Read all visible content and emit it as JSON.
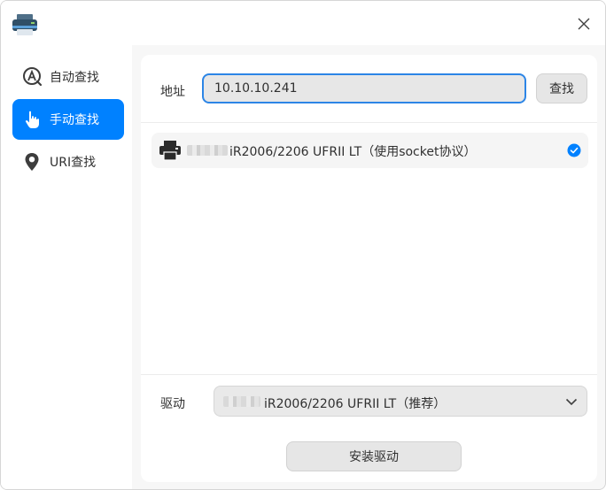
{
  "sidebar": {
    "items": [
      {
        "label": "自动查找",
        "icon": "auto-search-icon",
        "active": false
      },
      {
        "label": "手动查找",
        "icon": "hand-pointer-icon",
        "active": true
      },
      {
        "label": "URI查找",
        "icon": "location-pin-icon",
        "active": false
      }
    ]
  },
  "address": {
    "label": "地址",
    "value": "10.10.10.241",
    "search_label": "查找"
  },
  "printer": {
    "name": "iR2006/2206 UFRII LT（使用socket协议）",
    "selected": true
  },
  "driver": {
    "label": "驱动",
    "selected": "iR2006/2206 UFRII LT（推荐）"
  },
  "install_label": "安装驱动",
  "colors": {
    "accent": "#0081ff",
    "input_border": "#2c85e6"
  }
}
